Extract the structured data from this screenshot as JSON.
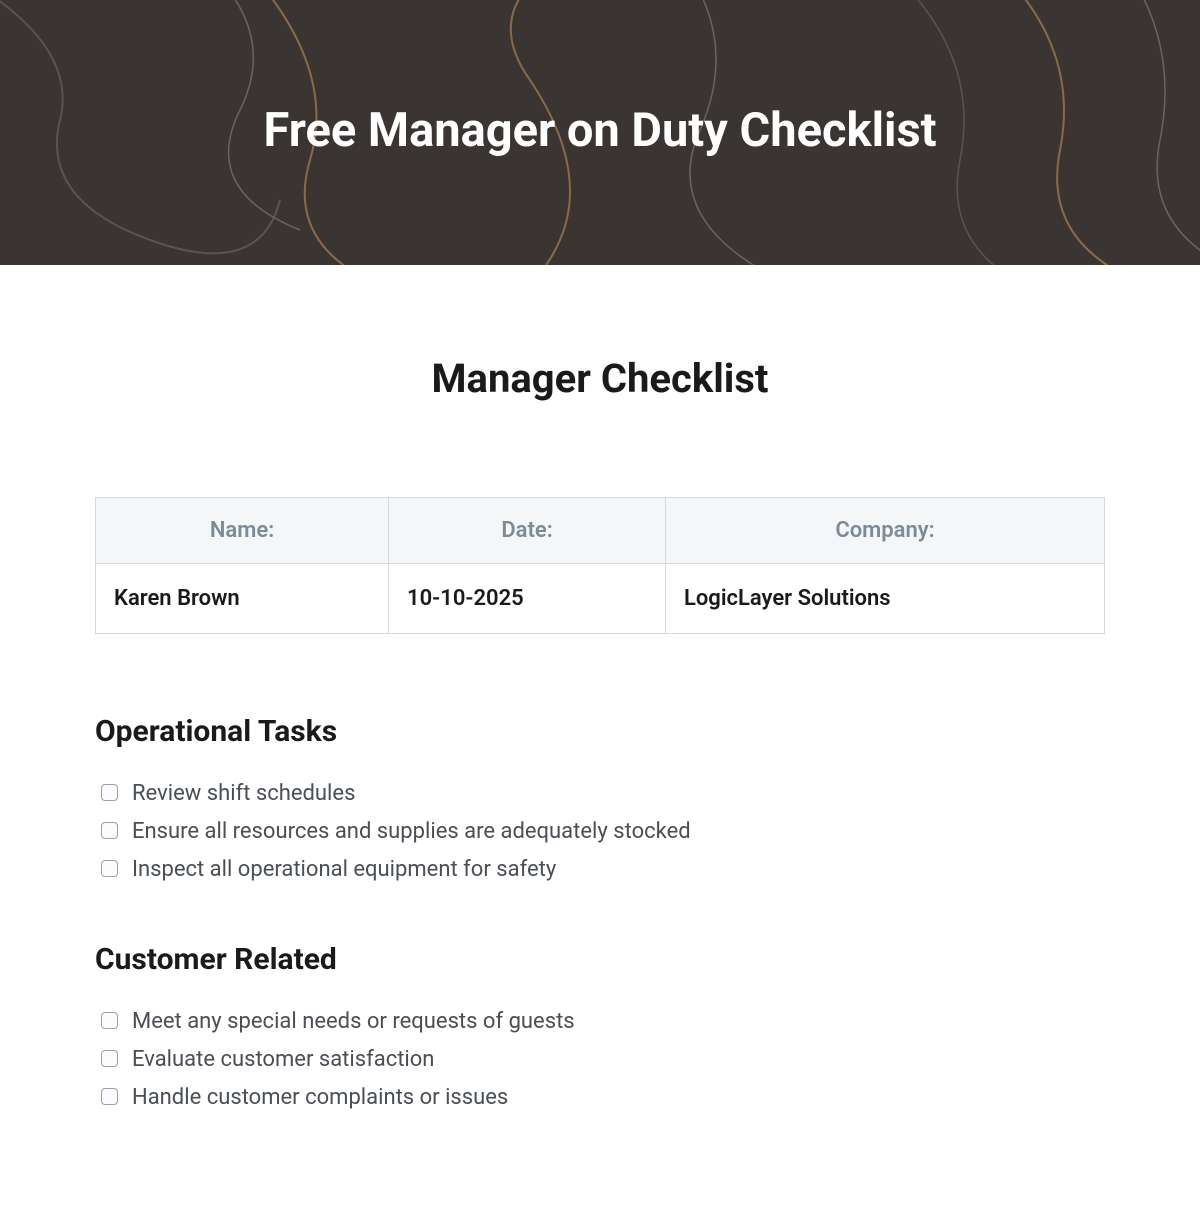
{
  "hero": {
    "title": "Free Manager on Duty Checklist"
  },
  "page": {
    "title": "Manager Checklist"
  },
  "info": {
    "headers": [
      "Name:",
      "Date:",
      "Company:"
    ],
    "values": [
      "Karen Brown",
      "10-10-2025",
      "LogicLayer Solutions"
    ]
  },
  "sections": [
    {
      "title": "Operational Tasks",
      "items": [
        "Review shift schedules",
        "Ensure all resources and supplies are adequately stocked",
        "Inspect all operational equipment for safety"
      ]
    },
    {
      "title": "Customer Related",
      "items": [
        "Meet any special needs or requests of guests",
        "Evaluate customer satisfaction",
        "Handle customer complaints or issues"
      ]
    }
  ]
}
